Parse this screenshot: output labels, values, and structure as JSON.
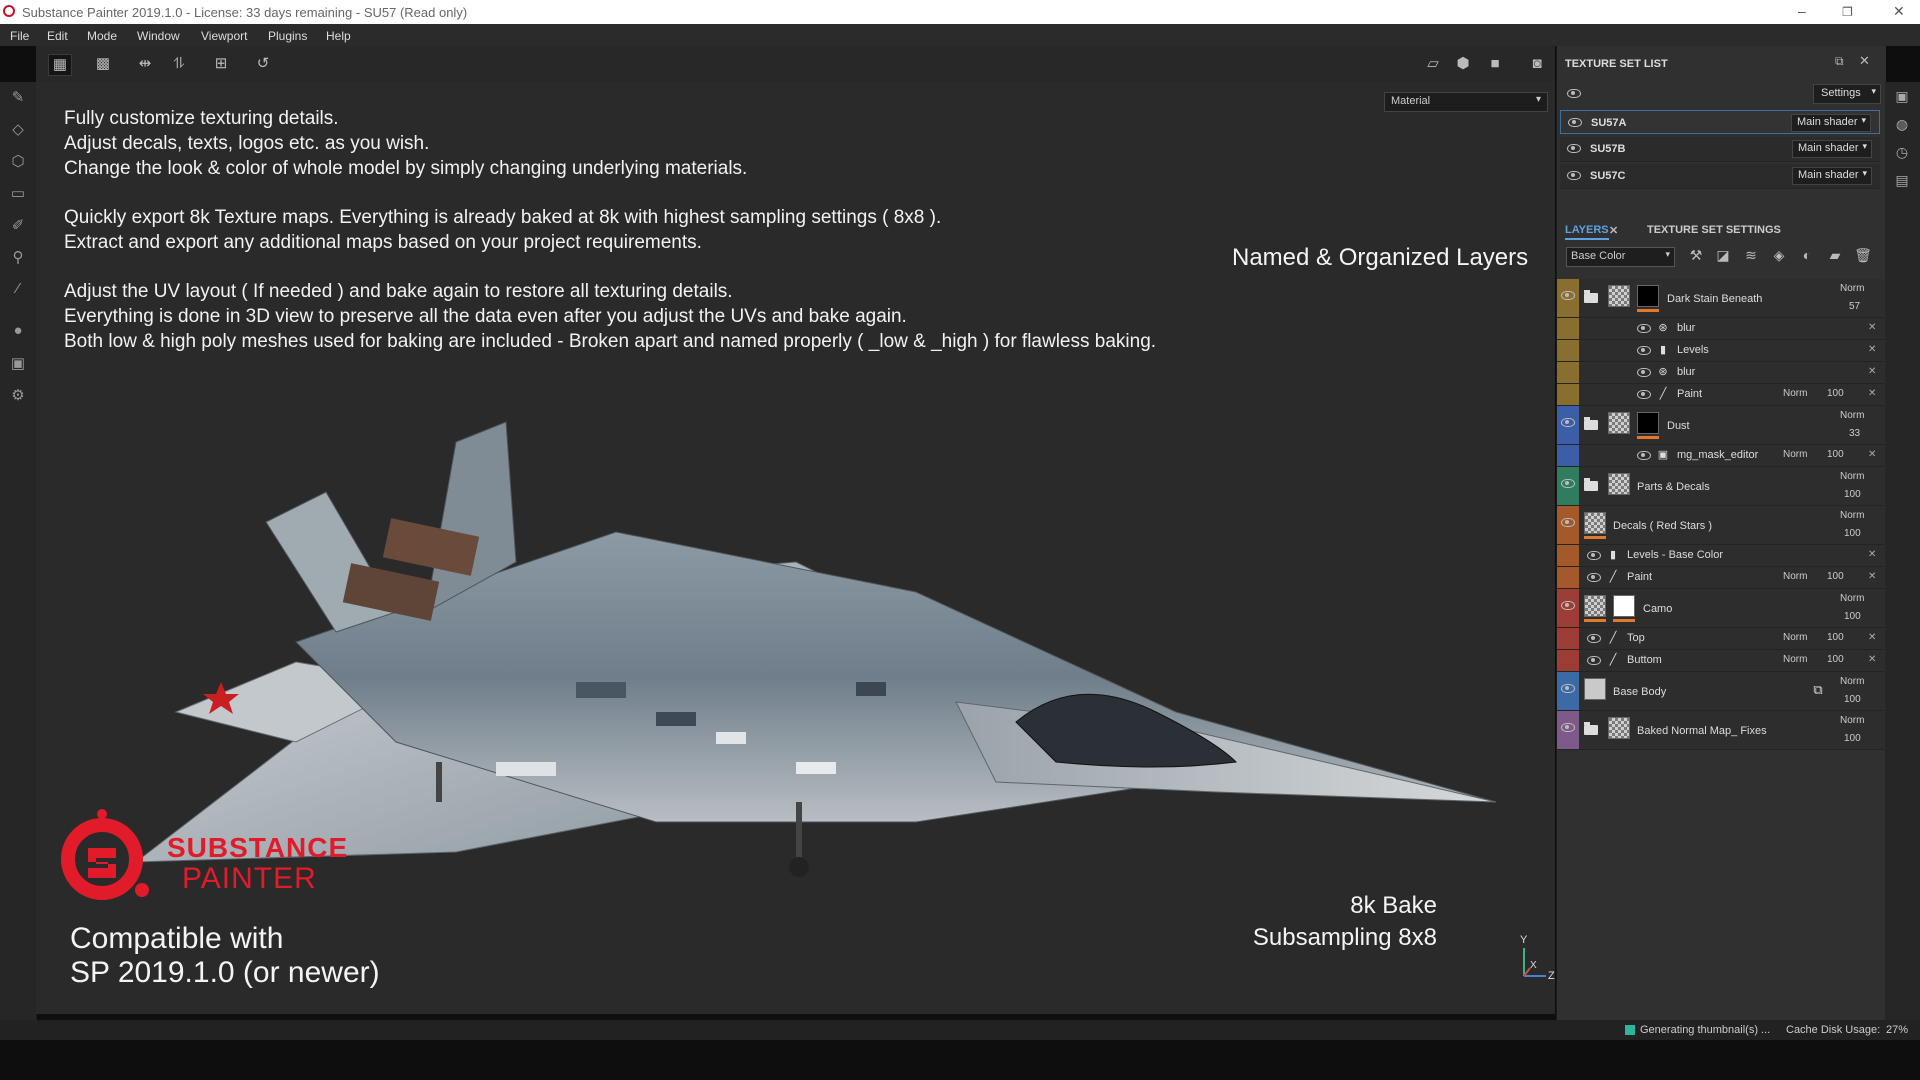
{
  "window": {
    "title": "Substance Painter 2019.1.0 - License: 33 days remaining - SU57 (Read only)",
    "minimize": "–",
    "maximize": "❐",
    "close": "✕"
  },
  "menu": [
    "File",
    "Edit",
    "Mode",
    "Window",
    "Viewport",
    "Plugins",
    "Help"
  ],
  "viewport": {
    "material_mode": "Material",
    "description_lines": [
      "Fully customize texturing details.",
      "Adjust decals, texts, logos etc. as you wish.",
      "Change the look & color of whole model by simply changing underlying materials.",
      "Quickly export 8k Texture maps. Everything is already baked at 8k with highest sampling settings ( 8x8 ).",
      "Extract and export any additional maps based on your project requirements.",
      "Adjust the UV layout ( If needed ) and bake again to restore all texturing details.",
      "Everything is done in 3D view to preserve all the data even after you adjust the UVs and bake again.",
      "Both low & high poly meshes used for baking are included - Broken apart and named properly ( _low & _high ) for flawless baking."
    ],
    "named_layers_caption": "Named & Organized Layers",
    "logo_line1": "SUBSTANCE",
    "logo_line2": "PAINTER",
    "compat_line1": "Compatible with",
    "compat_line2": "SP 2019.1.0 (or newer)",
    "bake_line1": "8k Bake",
    "bake_line2": "Subsampling 8x8",
    "axis_y": "Y",
    "axis_x": "X",
    "axis_z": "Z"
  },
  "texture_set_list": {
    "title": "TEXTURE SET LIST",
    "settings_label": "Settings",
    "sets": [
      {
        "name": "SU57A",
        "shader": "Main shader"
      },
      {
        "name": "SU57B",
        "shader": "Main shader"
      },
      {
        "name": "SU57C",
        "shader": "Main shader"
      }
    ]
  },
  "layers_panel": {
    "tab_layers": "LAYERS",
    "tab_settings": "TEXTURE SET SETTINGS",
    "channel": "Base Color",
    "rows": [
      {
        "name": "Dark Stain Beneath",
        "blend": "Norm",
        "opacity": "57"
      },
      {
        "name": "blur"
      },
      {
        "name": "Levels"
      },
      {
        "name": "blur"
      },
      {
        "name": "Paint",
        "blend": "Norm",
        "opacity": "100"
      },
      {
        "name": "Dust",
        "blend": "Norm",
        "opacity": "33"
      },
      {
        "name": "mg_mask_editor",
        "blend": "Norm",
        "opacity": "100"
      },
      {
        "name": "Parts & Decals",
        "blend": "Norm",
        "opacity": "100"
      },
      {
        "name": "Decals ( Red Stars )",
        "blend": "Norm",
        "opacity": "100"
      },
      {
        "name": "Levels - Base Color"
      },
      {
        "name": "Paint",
        "blend": "Norm",
        "opacity": "100"
      },
      {
        "name": "Camo",
        "blend": "Norm",
        "opacity": "100"
      },
      {
        "name": "Top",
        "blend": "Norm",
        "opacity": "100"
      },
      {
        "name": "Buttom",
        "blend": "Norm",
        "opacity": "100"
      },
      {
        "name": "Base Body",
        "blend": "Norm",
        "opacity": "100"
      },
      {
        "name": "Baked Normal Map_ Fixes",
        "blend": "Norm",
        "opacity": "100"
      }
    ],
    "group_colors": {
      "stain": "#8a6e2f",
      "dust": "#3b5ea6",
      "parts": "#2f7d5e",
      "decals": "#a4592b",
      "camo": "#9e3d36",
      "body": "#3b6aa6",
      "normal": "#7e5a8a"
    }
  },
  "status": {
    "generating": "Generating thumbnail(s) ...",
    "cache": "Cache Disk Usage:",
    "cache_value": "27%"
  }
}
